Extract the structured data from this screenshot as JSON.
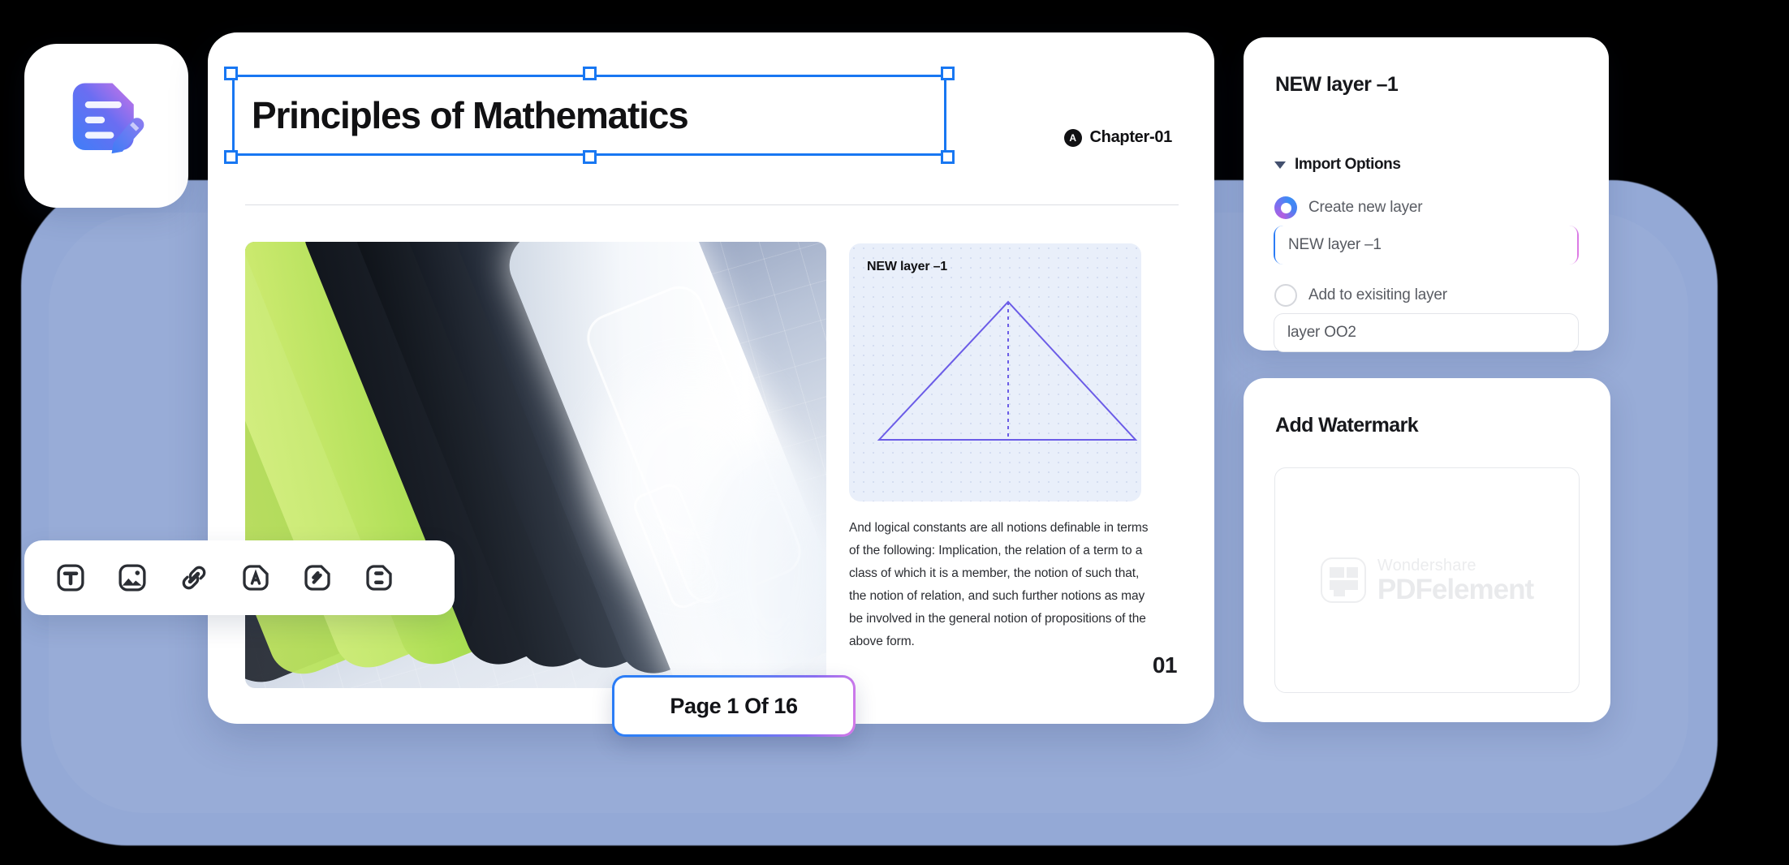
{
  "app": {
    "logo_icon": "document-pen-icon"
  },
  "document": {
    "title": "Principles of Mathematics",
    "chapter_badge_letter": "A",
    "chapter_label": "Chapter-01",
    "layer_preview_label": "NEW layer –1",
    "body_text": "And logical constants are all notions definable in terms of the following: Implication, the relation of a term to a class of which it is a member, the notion of such that, the notion of relation, and such further notions as may be involved in the general notion of propositions of the above form.",
    "page_number": "01",
    "page_badge": "Page 1 Of 16",
    "artwork_alt": "stacked translucent cases render"
  },
  "toolbar": {
    "items": [
      {
        "icon": "text-box-icon",
        "name": "add-text-tool"
      },
      {
        "icon": "image-icon",
        "name": "add-image-tool"
      },
      {
        "icon": "link-icon",
        "name": "add-link-tool"
      },
      {
        "icon": "ocr-letter-a-icon",
        "name": "ocr-tool"
      },
      {
        "icon": "edit-page-icon",
        "name": "edit-page-tool"
      },
      {
        "icon": "page-field-icon",
        "name": "form-field-tool"
      }
    ]
  },
  "import_panel": {
    "title": "NEW layer –1",
    "section_label": "Import Options",
    "caret_icon": "chevron-down-icon",
    "option_create": "Create new layer",
    "option_existing": "Add to exisiting layer",
    "new_layer_value": "NEW layer –1",
    "existing_layer_value": "layer OO2"
  },
  "watermark_panel": {
    "title": "Add Watermark",
    "watermark_brand_top": "Wondershare",
    "watermark_brand_main": "PDFelement"
  },
  "colors": {
    "accent_blue": "#1877f2",
    "gradient_start": "#2a7cf6",
    "gradient_end": "#d77ae8",
    "triangle_stroke": "#6b5ce7",
    "page_background": "#94a9d6"
  }
}
